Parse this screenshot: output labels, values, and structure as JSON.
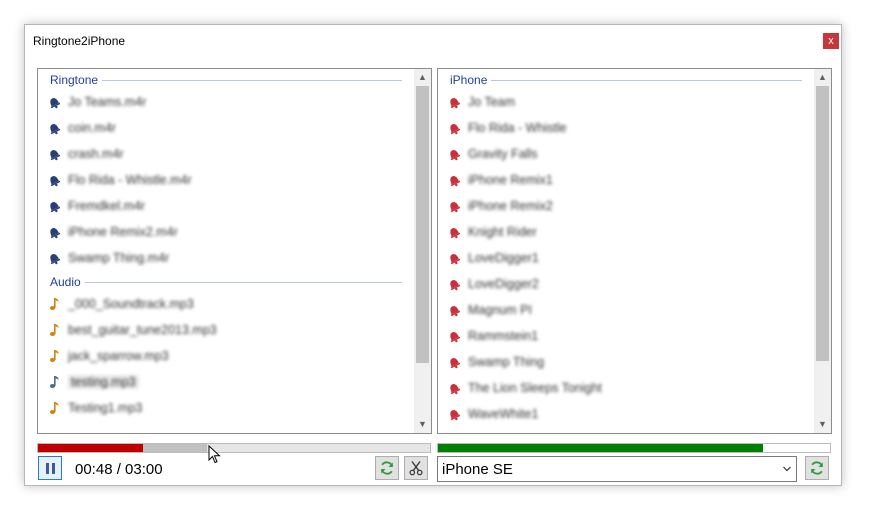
{
  "window": {
    "title": "Ringtone2iPhone",
    "close_label": "x"
  },
  "left_panel": {
    "groups": [
      {
        "header": "Ringtone",
        "icon": "bell-icon",
        "icon_color": "#2a3f73",
        "items": [
          "Jo Teams.m4r",
          "coin.m4r",
          "crash.m4r",
          "Flo Rida - Whistle.m4r",
          "Fremdkel.m4r",
          "iPhone Remix2.m4r",
          "Swamp Thing.m4r"
        ]
      },
      {
        "header": "Audio",
        "icon": "note-icon",
        "icon_color": "#d4820f",
        "items": [
          "_000_Soundtrack.mp3",
          "best_guitar_tune2013.mp3",
          "jack_sparrow.mp3",
          "testing.mp3",
          "Testing1.mp3"
        ],
        "selected_index": 3,
        "selected_icon_color": "#4a6b8a"
      }
    ]
  },
  "right_panel": {
    "groups": [
      {
        "header": "iPhone",
        "icon": "bell-icon",
        "icon_color": "#c8313a",
        "items": [
          "Jo Team",
          "Flo Rida - Whistle",
          "Gravity Falls",
          "iPhone Remix1",
          "iPhone Remix2",
          "Knight Rider",
          "LoveDigger1",
          "LoveDigger2",
          "Magnum PI",
          "Rammstein1",
          "Swamp Thing",
          "The Lion Sleeps Tonight",
          "WaveWhite1"
        ]
      }
    ]
  },
  "player": {
    "time": "00:48 / 03:00",
    "played_fraction": 0.267,
    "buffered_fraction": 0.43,
    "played_color": "#c00000",
    "buffered_color": "#c0c0c0"
  },
  "device": {
    "capacity_fraction": 0.83,
    "capacity_color": "#008000",
    "selected": "iPhone SE"
  }
}
